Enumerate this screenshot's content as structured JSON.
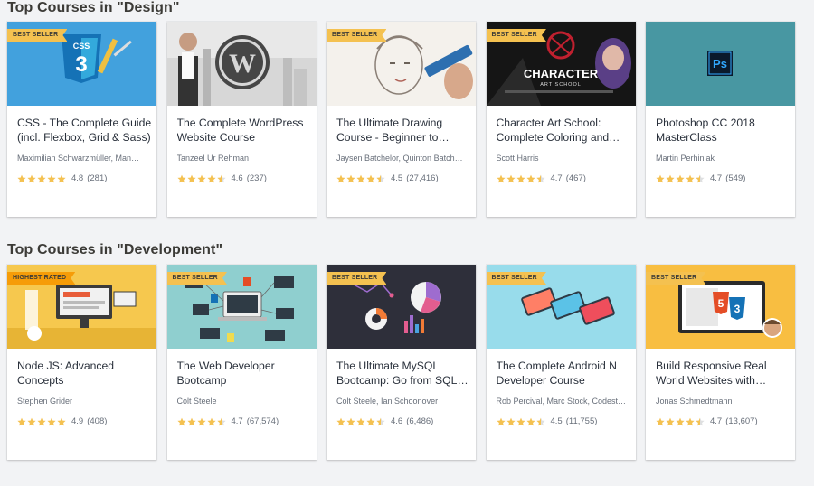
{
  "sections": [
    {
      "title": "Top Courses in \"Design\"",
      "courses": [
        {
          "badge": "BEST SELLER",
          "title": "CSS - The Complete Guide (incl. Flexbox, Grid & Sass)",
          "author": "Maximilian Schwarzmüller, Man…",
          "rating": "4.8",
          "count": "(281)",
          "stars": 5,
          "thumb": "css3-logo"
        },
        {
          "badge": "",
          "title": "The Complete WordPress Website Course",
          "author": "Tanzeel Ur Rehman",
          "rating": "4.6",
          "count": "(237)",
          "stars": 4.5,
          "thumb": "wordpress-logo"
        },
        {
          "badge": "BEST SELLER",
          "title": "The Ultimate Drawing Course - Beginner to…",
          "author": "Jaysen Batchelor, Quinton Batch…",
          "rating": "4.5",
          "count": "(27,416)",
          "stars": 4.5,
          "thumb": "drawing-sketch"
        },
        {
          "badge": "BEST SELLER",
          "title": "Character Art School: Complete Coloring and…",
          "author": "Scott Harris",
          "rating": "4.7",
          "count": "(467)",
          "stars": 4.5,
          "thumb": "character-art-school",
          "thumb_text": "CHARACTER",
          "thumb_subtext": "ART SCHOOL"
        },
        {
          "badge": "",
          "title": "Photoshop CC 2018 MasterClass",
          "author": "Martin Perhiniak",
          "rating": "4.7",
          "count": "(549)",
          "stars": 4.5,
          "thumb": "photoshop-logo",
          "thumb_text": "Ps"
        }
      ]
    },
    {
      "title": "Top Courses in \"Development\"",
      "courses": [
        {
          "badge": "HIGHEST RATED",
          "title": "Node JS: Advanced Concepts",
          "author": "Stephen Grider",
          "rating": "4.9",
          "count": "(408)",
          "stars": 5,
          "thumb": "node-desk"
        },
        {
          "badge": "BEST SELLER",
          "title": "The Web Developer Bootcamp",
          "author": "Colt Steele",
          "rating": "4.7",
          "count": "(67,574)",
          "stars": 4.5,
          "thumb": "laptop-code"
        },
        {
          "badge": "BEST SELLER",
          "title": "The Ultimate MySQL Bootcamp: Go from SQL…",
          "author": "Colt Steele, Ian Schoonover",
          "rating": "4.6",
          "count": "(6,486)",
          "stars": 4.5,
          "thumb": "sql-charts"
        },
        {
          "badge": "BEST SELLER",
          "title": "The Complete Android N Developer Course",
          "author": "Rob Percival, Marc Stock, Codest…",
          "rating": "4.5",
          "count": "(11,755)",
          "stars": 4.5,
          "thumb": "android-phones"
        },
        {
          "badge": "BEST SELLER",
          "title": "Build Responsive Real World Websites with…",
          "author": "Jonas Schmedtmann",
          "rating": "4.7",
          "count": "(13,607)",
          "stars": 4.5,
          "thumb": "html5-css3"
        }
      ]
    }
  ],
  "colors": {
    "star": "#f4c150",
    "badge": "#f4c150",
    "badge_highest": "#f69c08"
  }
}
